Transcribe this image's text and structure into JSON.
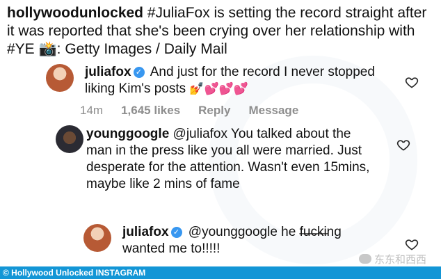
{
  "post_caption": {
    "handle": "hollywoodunlocked",
    "text": " #JuliaFox is setting the record straight after it was reported that she's been crying over her relationship with #YE 📸: Getty Images / Daily Mail"
  },
  "comments": [
    {
      "username": "juliafox",
      "verified": true,
      "text": "And just for the record I never stopped liking Kim's posts",
      "emoji": "💅💕💕💕",
      "time": "14m",
      "likes": "1,645 likes",
      "reply": "Reply",
      "message": "Message"
    },
    {
      "username": "younggoogle",
      "verified": false,
      "text": "@juliafox You talked about the man in the press like you all were married. Just desperate for the attention. Wasn't even 15mins, maybe like 2 mins of fame"
    },
    {
      "username": "juliafox",
      "verified": true,
      "text": "@younggoogle he f̶u̶c̶k̶ing wanted me to!!!!!"
    }
  ],
  "footer": {
    "credit": "© Hollywood Unlocked INSTAGRAM"
  },
  "wechat_watermark": "东东和西西",
  "colors": {
    "footer_bg": "#1396d6",
    "verified": "#3897f0",
    "meta_text": "#8e8e8e"
  },
  "icons": {
    "verified": "verified-badge-icon",
    "like": "heart-outline-icon"
  }
}
